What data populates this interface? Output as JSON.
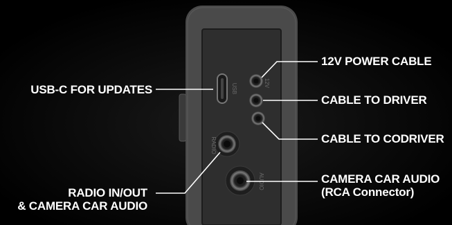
{
  "device": {
    "port_labels": {
      "usb": "USB",
      "v12": "12V",
      "radio": "RADIO",
      "audio": "AUDIO"
    }
  },
  "callouts": {
    "usb_c": "USB-C FOR UPDATES",
    "power_12v": "12V POWER CABLE",
    "driver": "CABLE TO DRIVER",
    "codriver": "CABLE TO CODRIVER",
    "camera_audio_line1": "CAMERA CAR AUDIO",
    "camera_audio_line2": "(RCA Connector)",
    "radio_line1": "RADIO IN/OUT",
    "radio_line2": "& CAMERA CAR AUDIO"
  },
  "colors": {
    "background": "#000000",
    "device_body": "#4a4a4a",
    "device_face": "#2f2f2f",
    "leader_line": "#ffffff",
    "text": "#ffffff"
  }
}
